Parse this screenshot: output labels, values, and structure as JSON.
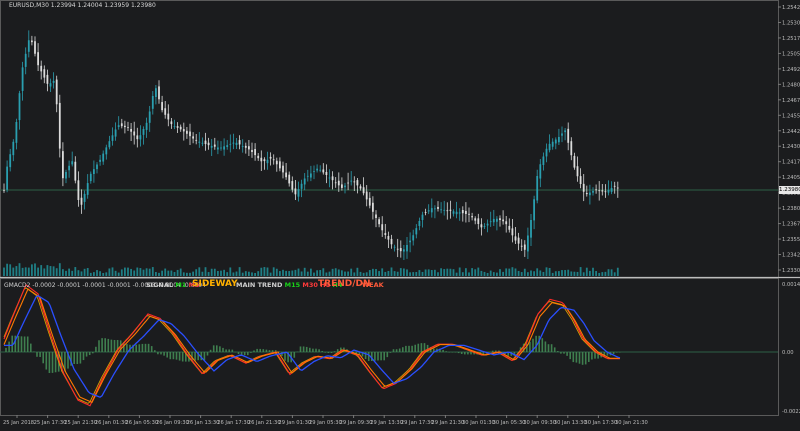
{
  "symbol_header": "EURUSD,M30 1.23994 1.24004 1.23959 1.23980",
  "indicator_header": "GMACD2 -0.0002 -0.0001 -0.0001 -0.0001 -0.0003 -0.0004 -0.0004",
  "signal": {
    "label": "SIGNAL",
    "tf1": "M1",
    "tf2": "M5",
    "state": "SIDEWAY"
  },
  "main_trend": {
    "label": "MAIN TREND",
    "tf1": "M15",
    "tf2": "M30",
    "tf3": "H1",
    "tf4": "H4",
    "state": "TREND/DN",
    "strength": "WEAK"
  },
  "current_price": "1.23980",
  "price_axis": [
    "1.25425",
    "1.25300",
    "1.25175",
    "1.25050",
    "1.24925",
    "1.24800",
    "1.24675",
    "1.24550",
    "1.24425",
    "1.24300",
    "1.24175",
    "1.24050",
    "1.23925",
    "1.23800",
    "1.23675",
    "1.23550",
    "1.23425",
    "1.23300"
  ],
  "indicator_axis": [
    "0.0014",
    "0.00",
    "-0.00229"
  ],
  "time_axis": [
    "25 Jan 2018",
    "25 Jan 17:30",
    "25 Jan 21:30",
    "26 Jan 01:30",
    "26 Jan 05:30",
    "26 Jan 09:30",
    "26 Jan 13:30",
    "26 Jan 17:30",
    "26 Jan 21:30",
    "29 Jan 01:30",
    "29 Jan 05:30",
    "29 Jan 09:30",
    "29 Jan 13:30",
    "29 Jan 17:30",
    "29 Jan 21:30",
    "30 Jan 01:30",
    "30 Jan 05:30",
    "30 Jan 09:30",
    "30 Jan 13:30",
    "30 Jan 17:30",
    "30 Jan 21:30"
  ],
  "colors": {
    "background": "#1b1c1e",
    "bull": "#2a9fb0",
    "bear": "#dcdcdc",
    "grid_zero": "#2e5f45",
    "volume": "#1f7f86",
    "histogram": "#3f7f4f",
    "macd_blue": "#2a4fff",
    "macd_orange": "#ff7a00",
    "macd_red": "#ff2a2a",
    "macd_gold": "#d9a000"
  }
}
